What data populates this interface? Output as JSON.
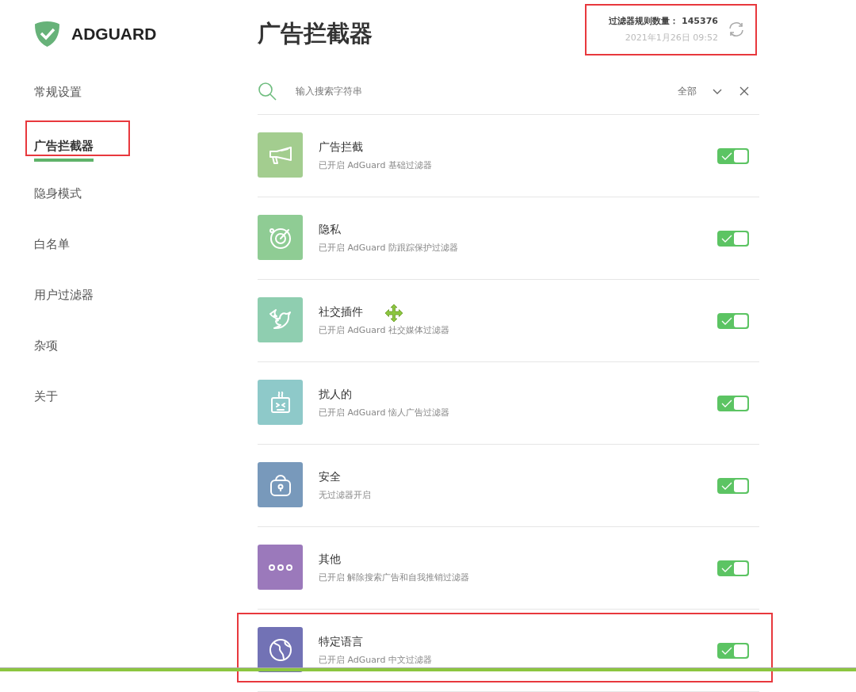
{
  "logo": {
    "text": "ADGUARD"
  },
  "sidebar": {
    "items": [
      {
        "label": "常规设置",
        "selected": false,
        "highlighted": false
      },
      {
        "label": "广告拦截器",
        "selected": true,
        "highlighted": true
      },
      {
        "label": "隐身模式",
        "selected": false,
        "highlighted": false
      },
      {
        "label": "白名单",
        "selected": false,
        "highlighted": false
      },
      {
        "label": "用户过滤器",
        "selected": false,
        "highlighted": false
      },
      {
        "label": "杂项",
        "selected": false,
        "highlighted": false
      },
      {
        "label": "关于",
        "selected": false,
        "highlighted": false
      }
    ]
  },
  "page_title": "广告拦截器",
  "stats": {
    "label": "过滤器规则数量：",
    "count": "145376",
    "updated": "2021年1月26日 09:52",
    "highlighted": true
  },
  "search": {
    "placeholder": "输入搜索字符串",
    "filter": "全部"
  },
  "groups": [
    {
      "title": "广告拦截",
      "subtitle": "已开启 AdGuard 基础过滤器",
      "color": "#a3cd8f",
      "on": true,
      "highlighted": false
    },
    {
      "title": "隐私",
      "subtitle": "已开启 AdGuard 防跟踪保护过滤器",
      "color": "#8fcc94",
      "on": true,
      "highlighted": false
    },
    {
      "title": "社交插件",
      "subtitle": "已开启 AdGuard 社交媒体过滤器",
      "color": "#8fceb0",
      "on": true,
      "highlighted": false
    },
    {
      "title": "扰人的",
      "subtitle": "已开启 AdGuard 恼人广告过滤器",
      "color": "#8ec9c9",
      "on": true,
      "highlighted": false
    },
    {
      "title": "安全",
      "subtitle": "无过滤器开启",
      "color": "#7899bb",
      "on": true,
      "highlighted": false
    },
    {
      "title": "其他",
      "subtitle": "已开启 解除搜索广告和自我推销过滤器",
      "color": "#9b79bb",
      "on": true,
      "highlighted": false
    },
    {
      "title": "特定语言",
      "subtitle": "已开启 AdGuard 中文过滤器",
      "color": "#7272b5",
      "on": true,
      "highlighted": true
    }
  ]
}
